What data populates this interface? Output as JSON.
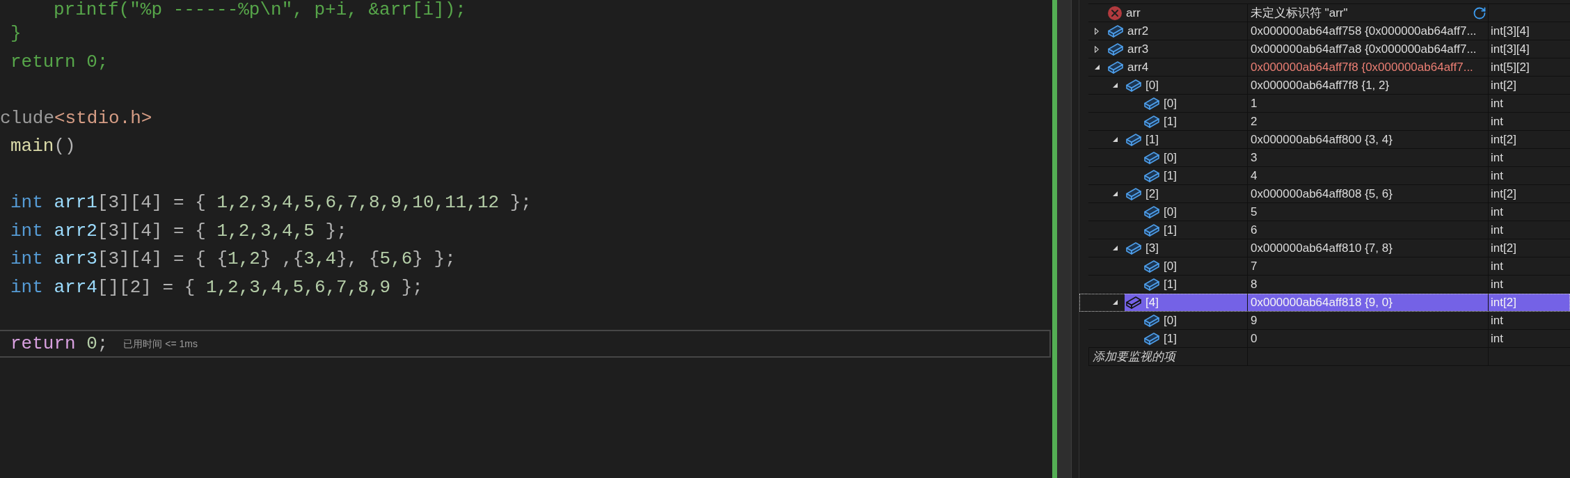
{
  "editor": {
    "lines": [
      {
        "kind": "nested",
        "current": false,
        "tokens": [
          {
            "kind": "comment",
            "text": "printf(\"%p ------%p\\n\", p+i, &arr[i]);"
          }
        ]
      },
      {
        "kind": "body",
        "current": false,
        "tokens": [
          {
            "kind": "comment",
            "text": "}"
          }
        ]
      },
      {
        "kind": "body",
        "current": false,
        "tokens": [
          {
            "kind": "comment",
            "text": "return 0;"
          }
        ]
      },
      {
        "kind": "blank"
      },
      {
        "kind": "edge",
        "current": false,
        "tokens": [
          {
            "kind": "preprocessor",
            "text": "clude"
          },
          {
            "kind": "include",
            "text": "<stdio.h>"
          }
        ]
      },
      {
        "kind": "body",
        "current": false,
        "tokens": [
          {
            "kind": "function",
            "text": "main"
          },
          {
            "kind": "punct",
            "text": "()"
          }
        ]
      },
      {
        "kind": "blank"
      },
      {
        "kind": "body",
        "current": false,
        "tokens": [
          {
            "kind": "keyword",
            "text": "int "
          },
          {
            "kind": "variable",
            "text": "arr1"
          },
          {
            "kind": "punct",
            "text": "[3][4] = { "
          },
          {
            "kind": "number",
            "text": "1,2,3,4,5,6,7,8,9,10,11,12"
          },
          {
            "kind": "punct",
            "text": " };"
          }
        ]
      },
      {
        "kind": "body",
        "current": false,
        "tokens": [
          {
            "kind": "keyword",
            "text": "int "
          },
          {
            "kind": "variable",
            "text": "arr2"
          },
          {
            "kind": "punct",
            "text": "[3][4] = { "
          },
          {
            "kind": "number",
            "text": "1,2,3,4,5"
          },
          {
            "kind": "punct",
            "text": " };"
          }
        ]
      },
      {
        "kind": "body",
        "current": false,
        "tokens": [
          {
            "kind": "keyword",
            "text": "int "
          },
          {
            "kind": "variable",
            "text": "arr3"
          },
          {
            "kind": "punct",
            "text": "[3][4] = { {"
          },
          {
            "kind": "number",
            "text": "1,2"
          },
          {
            "kind": "punct",
            "text": "} ,{"
          },
          {
            "kind": "number",
            "text": "3,4"
          },
          {
            "kind": "punct",
            "text": "}, {"
          },
          {
            "kind": "number",
            "text": "5,6"
          },
          {
            "kind": "punct",
            "text": "} };"
          }
        ]
      },
      {
        "kind": "body",
        "current": false,
        "tokens": [
          {
            "kind": "keyword",
            "text": "int "
          },
          {
            "kind": "variable",
            "text": "arr4"
          },
          {
            "kind": "punct",
            "text": "[][2] = { "
          },
          {
            "kind": "number",
            "text": "1,2,3,4,5,6,7,8,9"
          },
          {
            "kind": "punct",
            "text": " };"
          }
        ]
      },
      {
        "kind": "blank"
      },
      {
        "kind": "body",
        "current": true,
        "tokens": [
          {
            "kind": "control",
            "text": "return "
          },
          {
            "kind": "number",
            "text": "0"
          },
          {
            "kind": "punct",
            "text": ";"
          }
        ],
        "hint": "已用时间 <= 1ms"
      }
    ]
  },
  "watch": {
    "items": [
      {
        "kind": "error",
        "name": "arr",
        "value": "未定义标识符 \"arr\"",
        "selected": false,
        "changed": false
      },
      {
        "kind": "variable",
        "name": "arr2",
        "value": "0x000000ab64aff758 {0x000000ab64aff7...",
        "type": "int[3][4]",
        "expanded": false,
        "selected": false,
        "changed": false
      },
      {
        "kind": "variable",
        "name": "arr3",
        "value": "0x000000ab64aff7a8 {0x000000ab64aff7...",
        "type": "int[3][4]",
        "expanded": false,
        "selected": false,
        "changed": false
      },
      {
        "kind": "variable",
        "name": "arr4",
        "value": "0x000000ab64aff7f8 {0x000000ab64aff7...",
        "type": "int[5][2]",
        "expanded": true,
        "selected": false,
        "changed": true,
        "children": [
          {
            "kind": "variable",
            "name": "[0]",
            "value": "0x000000ab64aff7f8 {1, 2}",
            "type": "int[2]",
            "expanded": true,
            "selected": false,
            "changed": false,
            "children": [
              {
                "kind": "variable",
                "name": "[0]",
                "value": "1",
                "type": "int",
                "selected": false,
                "changed": false
              },
              {
                "kind": "variable",
                "name": "[1]",
                "value": "2",
                "type": "int",
                "selected": false,
                "changed": false
              }
            ]
          },
          {
            "kind": "variable",
            "name": "[1]",
            "value": "0x000000ab64aff800 {3, 4}",
            "type": "int[2]",
            "expanded": true,
            "selected": false,
            "changed": false,
            "children": [
              {
                "kind": "variable",
                "name": "[0]",
                "value": "3",
                "type": "int",
                "selected": false,
                "changed": false
              },
              {
                "kind": "variable",
                "name": "[1]",
                "value": "4",
                "type": "int",
                "selected": false,
                "changed": false
              }
            ]
          },
          {
            "kind": "variable",
            "name": "[2]",
            "value": "0x000000ab64aff808 {5, 6}",
            "type": "int[2]",
            "expanded": true,
            "selected": false,
            "changed": false,
            "children": [
              {
                "kind": "variable",
                "name": "[0]",
                "value": "5",
                "type": "int",
                "selected": false,
                "changed": false
              },
              {
                "kind": "variable",
                "name": "[1]",
                "value": "6",
                "type": "int",
                "selected": false,
                "changed": false
              }
            ]
          },
          {
            "kind": "variable",
            "name": "[3]",
            "value": "0x000000ab64aff810 {7, 8}",
            "type": "int[2]",
            "expanded": true,
            "selected": false,
            "changed": false,
            "children": [
              {
                "kind": "variable",
                "name": "[0]",
                "value": "7",
                "type": "int",
                "selected": false,
                "changed": false
              },
              {
                "kind": "variable",
                "name": "[1]",
                "value": "8",
                "type": "int",
                "selected": false,
                "changed": false
              }
            ]
          },
          {
            "kind": "variable",
            "name": "[4]",
            "value": "0x000000ab64aff818 {9, 0}",
            "type": "int[2]",
            "expanded": true,
            "selected": true,
            "changed": false,
            "children": [
              {
                "kind": "variable",
                "name": "[0]",
                "value": "9",
                "type": "int",
                "selected": false,
                "changed": false
              },
              {
                "kind": "variable",
                "name": "[1]",
                "value": "0",
                "type": "int",
                "selected": false,
                "changed": false
              }
            ]
          }
        ]
      }
    ],
    "add_watch": {
      "placeholder": "添加要监视的项"
    }
  }
}
